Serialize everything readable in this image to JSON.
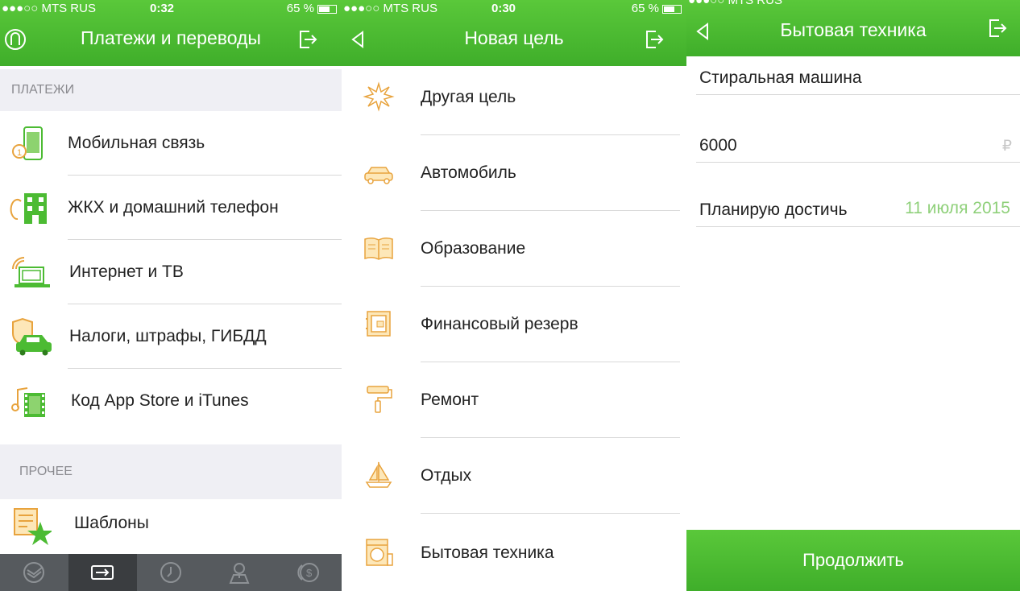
{
  "screen1": {
    "status": {
      "carrier": "●●●○○ MTS RUS",
      "time": "0:32",
      "battery": "65 %"
    },
    "title": "Платежи и переводы",
    "payments_header": "ПЛАТЕЖИ",
    "items": [
      {
        "label": "Мобильная связь",
        "icon": "mobile-phone-icon"
      },
      {
        "label": "ЖКХ и домашний телефон",
        "icon": "building-icon"
      },
      {
        "label": "Интернет и ТВ",
        "icon": "laptop-icon"
      },
      {
        "label": "Налоги, штрафы, ГИБДД",
        "icon": "car-shield-icon"
      },
      {
        "label": "Код App Store и iTunes",
        "icon": "music-film-icon"
      }
    ],
    "other_header": "ПРОЧЕЕ",
    "other_items": [
      {
        "label": "Шаблоны",
        "icon": "star-document-icon"
      }
    ],
    "tabs": [
      "sberbank-logo-icon",
      "transfer-icon",
      "clock-icon",
      "map-pin-icon",
      "coins-icon"
    ]
  },
  "screen2": {
    "status": {
      "carrier": "●●●○○ MTS RUS",
      "time": "0:30",
      "battery": "65 %"
    },
    "title": "Новая цель",
    "goals": [
      {
        "label": "Другая цель",
        "icon": "star-burst-icon"
      },
      {
        "label": "Автомобиль",
        "icon": "car-icon"
      },
      {
        "label": "Образование",
        "icon": "book-icon"
      },
      {
        "label": "Финансовый резерв",
        "icon": "safe-icon"
      },
      {
        "label": "Ремонт",
        "icon": "paint-roller-icon"
      },
      {
        "label": "Отдых",
        "icon": "sailboat-icon"
      },
      {
        "label": "Бытовая техника",
        "icon": "washing-machine-icon"
      }
    ]
  },
  "screen3": {
    "status": {
      "carrier": "●●●○○ MTS RUS"
    },
    "title": "Бытовая техника",
    "name_value": "Стиральная машина",
    "amount_value": "6000",
    "currency": "₽",
    "plan_label": "Планирую достичь",
    "plan_date": "11 июля 2015",
    "continue_label": "Продолжить"
  },
  "colors": {
    "green": "#4cbb33",
    "orange": "#e8a33d",
    "gray_bg": "#efeff4"
  }
}
